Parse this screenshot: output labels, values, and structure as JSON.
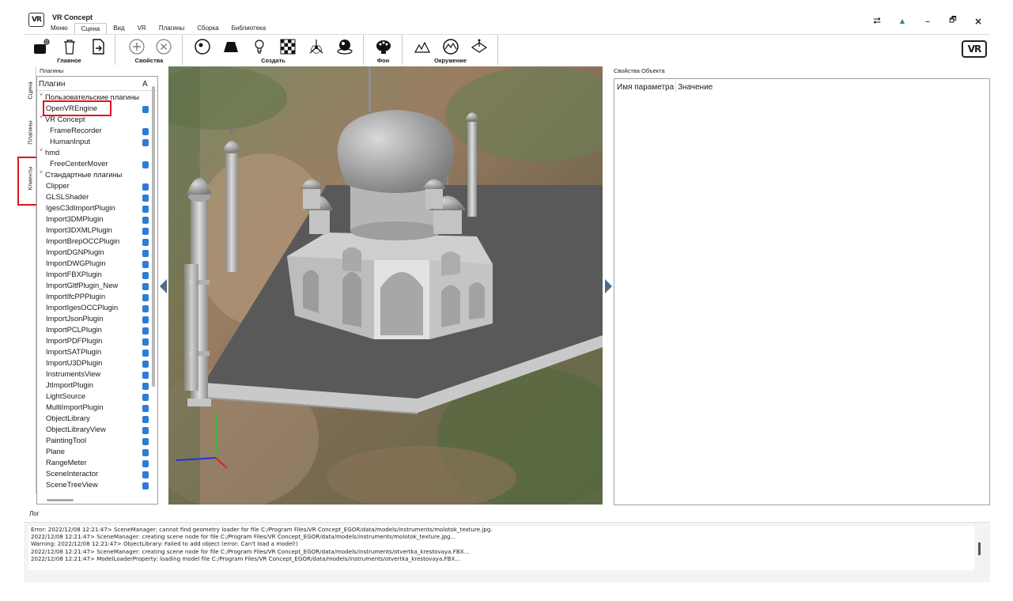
{
  "window": {
    "logo_text": "VR",
    "title": "VR Concept",
    "controls": [
      "⮂",
      "▲",
      "–",
      "🗗",
      "×"
    ]
  },
  "menu_tabs": [
    {
      "label": "Меню",
      "active": false
    },
    {
      "label": "Сцена",
      "active": true
    },
    {
      "label": "Вид",
      "active": false
    },
    {
      "label": "VR",
      "active": false
    },
    {
      "label": "Плагины",
      "active": false
    },
    {
      "label": "Сборка",
      "active": false
    },
    {
      "label": "Библиотека",
      "active": false
    }
  ],
  "ribbon": {
    "groups": [
      {
        "label": "Главное",
        "icons": [
          "new-scene-icon",
          "trash-icon",
          "import-icon"
        ]
      },
      {
        "label": "Свойства",
        "icons": [
          "add-circle-icon",
          "remove-circle-icon"
        ]
      },
      {
        "label": "Создать",
        "icons": [
          "sphere-icon",
          "trapezoid-icon",
          "light-bulb-icon",
          "checker-icon",
          "axes-icon",
          "material-icon"
        ]
      },
      {
        "label": "Фон",
        "icons": [
          "palette-icon"
        ]
      },
      {
        "label": "Окружение",
        "icons": [
          "terrain-icon",
          "environment-icon",
          "plane-pointer-icon"
        ]
      }
    ],
    "brand_logo": "VR"
  },
  "side_tabs": [
    {
      "label": "Сцена"
    },
    {
      "label": "Плагины"
    },
    {
      "label": "Клиенты"
    }
  ],
  "plugins": {
    "title": "Плагины",
    "header": {
      "col1": "Плагин",
      "col2": "А"
    },
    "rows": [
      {
        "label": "Пользовательские плагины",
        "level": 0,
        "expand": true,
        "checked": false
      },
      {
        "label": "OpenVREngine",
        "level": 1,
        "expand": false,
        "checked": true
      },
      {
        "label": "VR Concept",
        "level": 0,
        "expand": true,
        "checked": false
      },
      {
        "label": "FrameRecorder",
        "level": 2,
        "expand": false,
        "checked": true
      },
      {
        "label": "HumanInput",
        "level": 2,
        "expand": false,
        "checked": true
      },
      {
        "label": "hmd",
        "level": 0,
        "expand": true,
        "checked": false
      },
      {
        "label": "FreeCenterMover",
        "level": 2,
        "expand": false,
        "checked": true
      },
      {
        "label": "Стандартные плагины",
        "level": 0,
        "expand": true,
        "checked": false
      },
      {
        "label": "Clipper",
        "level": 1,
        "expand": false,
        "checked": true
      },
      {
        "label": "GLSLShader",
        "level": 1,
        "expand": false,
        "checked": true
      },
      {
        "label": "IgesC3dImportPlugin",
        "level": 1,
        "expand": false,
        "checked": true
      },
      {
        "label": "Import3DMPlugin",
        "level": 1,
        "expand": false,
        "checked": true
      },
      {
        "label": "Import3DXMLPlugin",
        "level": 1,
        "expand": false,
        "checked": true
      },
      {
        "label": "ImportBrepOCCPlugin",
        "level": 1,
        "expand": false,
        "checked": true
      },
      {
        "label": "ImportDGNPlugin",
        "level": 1,
        "expand": false,
        "checked": true
      },
      {
        "label": "ImportDWGPlugin",
        "level": 1,
        "expand": false,
        "checked": true
      },
      {
        "label": "ImportFBXPlugin",
        "level": 1,
        "expand": false,
        "checked": true
      },
      {
        "label": "ImportGltfPlugin_New",
        "level": 1,
        "expand": false,
        "checked": true
      },
      {
        "label": "ImportIfcPPPlugin",
        "level": 1,
        "expand": false,
        "checked": true
      },
      {
        "label": "ImportIgesOCCPlugin",
        "level": 1,
        "expand": false,
        "checked": true
      },
      {
        "label": "ImportJsonPlugin",
        "level": 1,
        "expand": false,
        "checked": true
      },
      {
        "label": "ImportPCLPlugin",
        "level": 1,
        "expand": false,
        "checked": true
      },
      {
        "label": "ImportPDFPlugin",
        "level": 1,
        "expand": false,
        "checked": true
      },
      {
        "label": "ImportSATPlugin",
        "level": 1,
        "expand": false,
        "checked": true
      },
      {
        "label": "ImportU3DPlugin",
        "level": 1,
        "expand": false,
        "checked": true
      },
      {
        "label": "InstrumentsView",
        "level": 1,
        "expand": false,
        "checked": true
      },
      {
        "label": "JtImportPlugin",
        "level": 1,
        "expand": false,
        "checked": true
      },
      {
        "label": "LightSource",
        "level": 1,
        "expand": false,
        "checked": true
      },
      {
        "label": "MultiImportPlugin",
        "level": 1,
        "expand": false,
        "checked": true
      },
      {
        "label": "ObjectLibrary",
        "level": 1,
        "expand": false,
        "checked": true
      },
      {
        "label": "ObjectLibraryView",
        "level": 1,
        "expand": false,
        "checked": true
      },
      {
        "label": "PaintingTool",
        "level": 1,
        "expand": false,
        "checked": true
      },
      {
        "label": "Plane",
        "level": 1,
        "expand": false,
        "checked": true
      },
      {
        "label": "RangeMeter",
        "level": 1,
        "expand": false,
        "checked": true
      },
      {
        "label": "SceneInteractor",
        "level": 1,
        "expand": false,
        "checked": true
      },
      {
        "label": "SceneTreeView",
        "level": 1,
        "expand": false,
        "checked": true
      }
    ]
  },
  "properties": {
    "title": "Свойства Объекта",
    "col_name": "Имя параметра",
    "col_value": "Значение"
  },
  "log": {
    "title": "Лог",
    "lines": [
      "Error: 2022/12/08 12:21:47> SceneManager: cannot find geometry loader for file C:/Program Files/VR Concept_EGOR/data/models/instruments/molotok_texture.jpg.",
      "2022/12/08 12:21:47> SceneManager: creating scene node for file C:/Program Files/VR Concept_EGOR/data/models/instruments/molotok_texture.jpg...",
      "Warning: 2022/12/08 12:21:47> ObjectLibrary: Failed to add object (error: Can't load a model!)",
      "2022/12/08 12:21:47> SceneManager: creating scene node for file C:/Program Files/VR Concept_EGOR/data/models/instruments/otvertka_krestovaya.FBX...",
      "2022/12/08 12:21:47> ModelLoaderProperty: loading model file C:/Program Files/VR Concept_EGOR/data/models/instruments/otvertka_krestovaya.FBX..."
    ]
  },
  "colors": {
    "check": "#2e7cd8",
    "highlight": "#e0141e",
    "panel_arrow": "#4a6d8e"
  }
}
